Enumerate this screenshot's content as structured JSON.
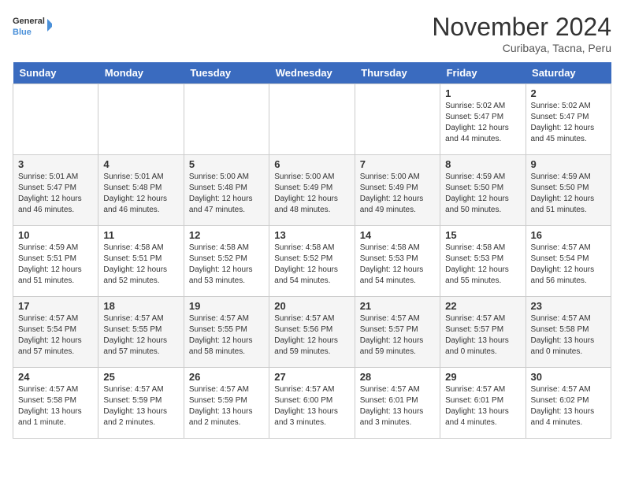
{
  "header": {
    "logo_general": "General",
    "logo_blue": "Blue",
    "month_title": "November 2024",
    "location": "Curibaya, Tacna, Peru"
  },
  "days_of_week": [
    "Sunday",
    "Monday",
    "Tuesday",
    "Wednesday",
    "Thursday",
    "Friday",
    "Saturday"
  ],
  "weeks": [
    [
      {
        "day": "",
        "info": ""
      },
      {
        "day": "",
        "info": ""
      },
      {
        "day": "",
        "info": ""
      },
      {
        "day": "",
        "info": ""
      },
      {
        "day": "",
        "info": ""
      },
      {
        "day": "1",
        "info": "Sunrise: 5:02 AM\nSunset: 5:47 PM\nDaylight: 12 hours\nand 44 minutes."
      },
      {
        "day": "2",
        "info": "Sunrise: 5:02 AM\nSunset: 5:47 PM\nDaylight: 12 hours\nand 45 minutes."
      }
    ],
    [
      {
        "day": "3",
        "info": "Sunrise: 5:01 AM\nSunset: 5:47 PM\nDaylight: 12 hours\nand 46 minutes."
      },
      {
        "day": "4",
        "info": "Sunrise: 5:01 AM\nSunset: 5:48 PM\nDaylight: 12 hours\nand 46 minutes."
      },
      {
        "day": "5",
        "info": "Sunrise: 5:00 AM\nSunset: 5:48 PM\nDaylight: 12 hours\nand 47 minutes."
      },
      {
        "day": "6",
        "info": "Sunrise: 5:00 AM\nSunset: 5:49 PM\nDaylight: 12 hours\nand 48 minutes."
      },
      {
        "day": "7",
        "info": "Sunrise: 5:00 AM\nSunset: 5:49 PM\nDaylight: 12 hours\nand 49 minutes."
      },
      {
        "day": "8",
        "info": "Sunrise: 4:59 AM\nSunset: 5:50 PM\nDaylight: 12 hours\nand 50 minutes."
      },
      {
        "day": "9",
        "info": "Sunrise: 4:59 AM\nSunset: 5:50 PM\nDaylight: 12 hours\nand 51 minutes."
      }
    ],
    [
      {
        "day": "10",
        "info": "Sunrise: 4:59 AM\nSunset: 5:51 PM\nDaylight: 12 hours\nand 51 minutes."
      },
      {
        "day": "11",
        "info": "Sunrise: 4:58 AM\nSunset: 5:51 PM\nDaylight: 12 hours\nand 52 minutes."
      },
      {
        "day": "12",
        "info": "Sunrise: 4:58 AM\nSunset: 5:52 PM\nDaylight: 12 hours\nand 53 minutes."
      },
      {
        "day": "13",
        "info": "Sunrise: 4:58 AM\nSunset: 5:52 PM\nDaylight: 12 hours\nand 54 minutes."
      },
      {
        "day": "14",
        "info": "Sunrise: 4:58 AM\nSunset: 5:53 PM\nDaylight: 12 hours\nand 54 minutes."
      },
      {
        "day": "15",
        "info": "Sunrise: 4:58 AM\nSunset: 5:53 PM\nDaylight: 12 hours\nand 55 minutes."
      },
      {
        "day": "16",
        "info": "Sunrise: 4:57 AM\nSunset: 5:54 PM\nDaylight: 12 hours\nand 56 minutes."
      }
    ],
    [
      {
        "day": "17",
        "info": "Sunrise: 4:57 AM\nSunset: 5:54 PM\nDaylight: 12 hours\nand 57 minutes."
      },
      {
        "day": "18",
        "info": "Sunrise: 4:57 AM\nSunset: 5:55 PM\nDaylight: 12 hours\nand 57 minutes."
      },
      {
        "day": "19",
        "info": "Sunrise: 4:57 AM\nSunset: 5:55 PM\nDaylight: 12 hours\nand 58 minutes."
      },
      {
        "day": "20",
        "info": "Sunrise: 4:57 AM\nSunset: 5:56 PM\nDaylight: 12 hours\nand 59 minutes."
      },
      {
        "day": "21",
        "info": "Sunrise: 4:57 AM\nSunset: 5:57 PM\nDaylight: 12 hours\nand 59 minutes."
      },
      {
        "day": "22",
        "info": "Sunrise: 4:57 AM\nSunset: 5:57 PM\nDaylight: 13 hours\nand 0 minutes."
      },
      {
        "day": "23",
        "info": "Sunrise: 4:57 AM\nSunset: 5:58 PM\nDaylight: 13 hours\nand 0 minutes."
      }
    ],
    [
      {
        "day": "24",
        "info": "Sunrise: 4:57 AM\nSunset: 5:58 PM\nDaylight: 13 hours\nand 1 minute."
      },
      {
        "day": "25",
        "info": "Sunrise: 4:57 AM\nSunset: 5:59 PM\nDaylight: 13 hours\nand 2 minutes."
      },
      {
        "day": "26",
        "info": "Sunrise: 4:57 AM\nSunset: 5:59 PM\nDaylight: 13 hours\nand 2 minutes."
      },
      {
        "day": "27",
        "info": "Sunrise: 4:57 AM\nSunset: 6:00 PM\nDaylight: 13 hours\nand 3 minutes."
      },
      {
        "day": "28",
        "info": "Sunrise: 4:57 AM\nSunset: 6:01 PM\nDaylight: 13 hours\nand 3 minutes."
      },
      {
        "day": "29",
        "info": "Sunrise: 4:57 AM\nSunset: 6:01 PM\nDaylight: 13 hours\nand 4 minutes."
      },
      {
        "day": "30",
        "info": "Sunrise: 4:57 AM\nSunset: 6:02 PM\nDaylight: 13 hours\nand 4 minutes."
      }
    ]
  ]
}
